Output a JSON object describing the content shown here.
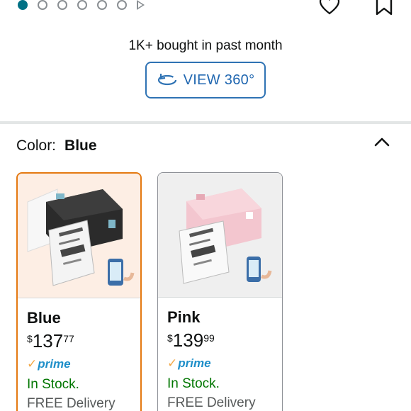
{
  "carousel": {
    "total_dots": 6,
    "active_index": 0
  },
  "header": {
    "bought_text": "1K+ bought in past month",
    "view360_label": "VIEW 360°"
  },
  "color_selector": {
    "label": "Color:",
    "selected": "Blue"
  },
  "variants": [
    {
      "name": "Blue",
      "price_symbol": "$",
      "price_whole": "137",
      "price_fraction": "77",
      "prime": "prime",
      "stock": "In Stock.",
      "delivery": "FREE Delivery",
      "selected": true
    },
    {
      "name": "Pink",
      "price_symbol": "$",
      "price_whole": "139",
      "price_fraction": "99",
      "prime": "prime",
      "stock": "In Stock.",
      "delivery": "FREE Delivery",
      "selected": false
    }
  ],
  "colors": {
    "accent_blue": "#2f73b4",
    "selected_border": "#e47911",
    "in_stock": "#007600",
    "prime_blue": "#1f8fc9",
    "prime_check": "#f3a847",
    "active_dot": "#007185"
  },
  "icons": [
    "play-icon",
    "heart-icon",
    "bookmark-icon",
    "rotate-360-icon",
    "chevron-up-icon",
    "prime-check-icon"
  ]
}
